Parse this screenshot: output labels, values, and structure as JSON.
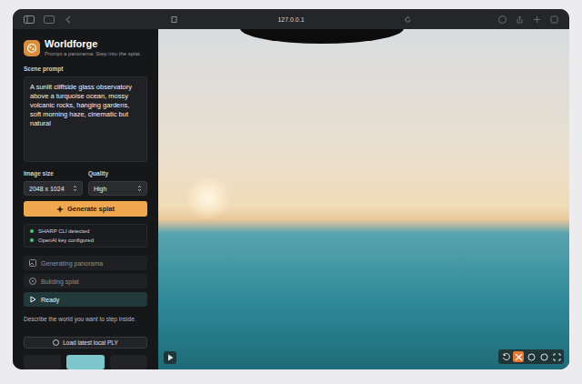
{
  "browser": {
    "url": "127.0.0.1"
  },
  "app": {
    "title": "Worldforge",
    "subtitle": "Prompt a panorama. Step into the splat."
  },
  "prompt": {
    "label": "Scene prompt",
    "text": "A sunlit cliffside glass observatory above a turquoise ocean, mossy volcanic rocks, hanging gardens, soft morning haze, cinematic but natural"
  },
  "fields": [
    {
      "label": "Image size",
      "value": "2048 x 1024"
    },
    {
      "label": "Quality",
      "value": "High"
    }
  ],
  "generate_button": "Generate splat",
  "status": [
    {
      "text": "SHARP CLI detected",
      "color": "#3ecf6e"
    },
    {
      "text": "OpenAI key configured",
      "color": "#3ecf6e"
    }
  ],
  "steps": [
    {
      "label": "Generating panorama",
      "kind": "image",
      "selected": false
    },
    {
      "label": "Building splat",
      "kind": "cube",
      "selected": false
    },
    {
      "label": "Ready",
      "kind": "play",
      "selected": true
    }
  ],
  "hint": "Describe the world you want to step inside.",
  "load_button": "Load latest local PLY",
  "view_modes": [
    {
      "selected": false
    },
    {
      "selected": true
    },
    {
      "selected": false
    }
  ],
  "viewer_tools": [
    {
      "kind": "reset",
      "selected": false
    },
    {
      "kind": "move",
      "selected": true
    },
    {
      "kind": "info",
      "selected": false
    },
    {
      "kind": "settings",
      "selected": false
    },
    {
      "kind": "fullscreen",
      "selected": false
    }
  ]
}
